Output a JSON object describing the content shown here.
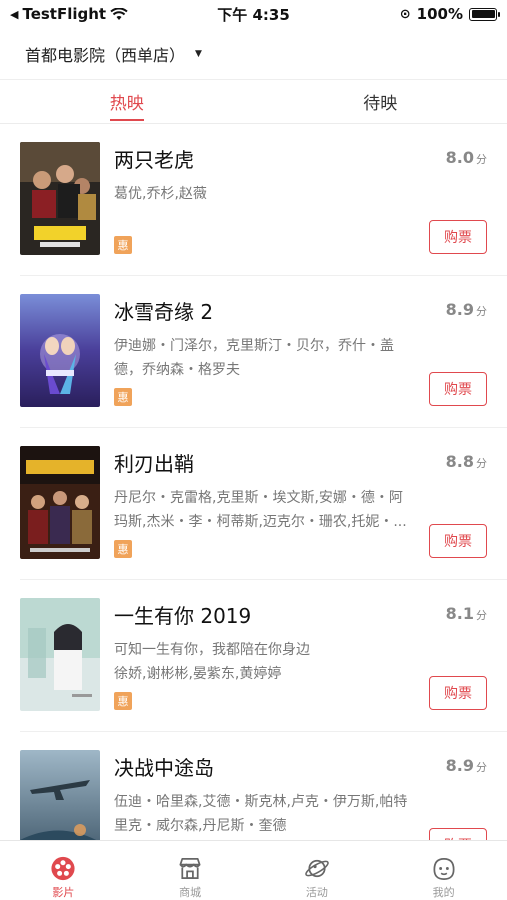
{
  "status": {
    "carrier": "TestFlight",
    "time": "下午 4:35",
    "battery": "100%"
  },
  "cinema": {
    "name": "首都电影院（西单店）"
  },
  "tabs": [
    {
      "label": "热映"
    },
    {
      "label": "待映"
    }
  ],
  "score_unit": "分",
  "badge_label": "惠",
  "buy_label": "购票",
  "movies": [
    {
      "title": "两只老虎",
      "score": "8.0",
      "line1": "葛优,乔杉,赵薇",
      "line2": ""
    },
    {
      "title": "冰雪奇缘 2",
      "score": "8.9",
      "line1": "伊迪娜・门泽尔，克里斯汀・贝尔，乔什・盖",
      "line2": "德，乔纳森・格罗夫"
    },
    {
      "title": "利刃出鞘",
      "score": "8.8",
      "line1": "丹尼尔・克雷格,克里斯・埃文斯,安娜・德・阿",
      "line2": "玛斯,杰米・李・柯蒂斯,迈克尔・珊农,托妮・..."
    },
    {
      "title": "一生有你 2019",
      "score": "8.1",
      "line1": "可知一生有你，我都陪在你身边",
      "line2": "徐娇,谢彬彬,晏紫东,黄婷婷"
    },
    {
      "title": "决战中途岛",
      "score": "8.9",
      "line1": "伍迪・哈里森,艾德・斯克林,卢克・伊万斯,帕特",
      "line2": "里克・威尔森,丹尼斯・奎德"
    }
  ],
  "tabbar": [
    {
      "label": "影片"
    },
    {
      "label": "商城"
    },
    {
      "label": "活动"
    },
    {
      "label": "我的"
    }
  ],
  "colors": {
    "accent": "#e0494e",
    "badge": "#f0a35a"
  }
}
